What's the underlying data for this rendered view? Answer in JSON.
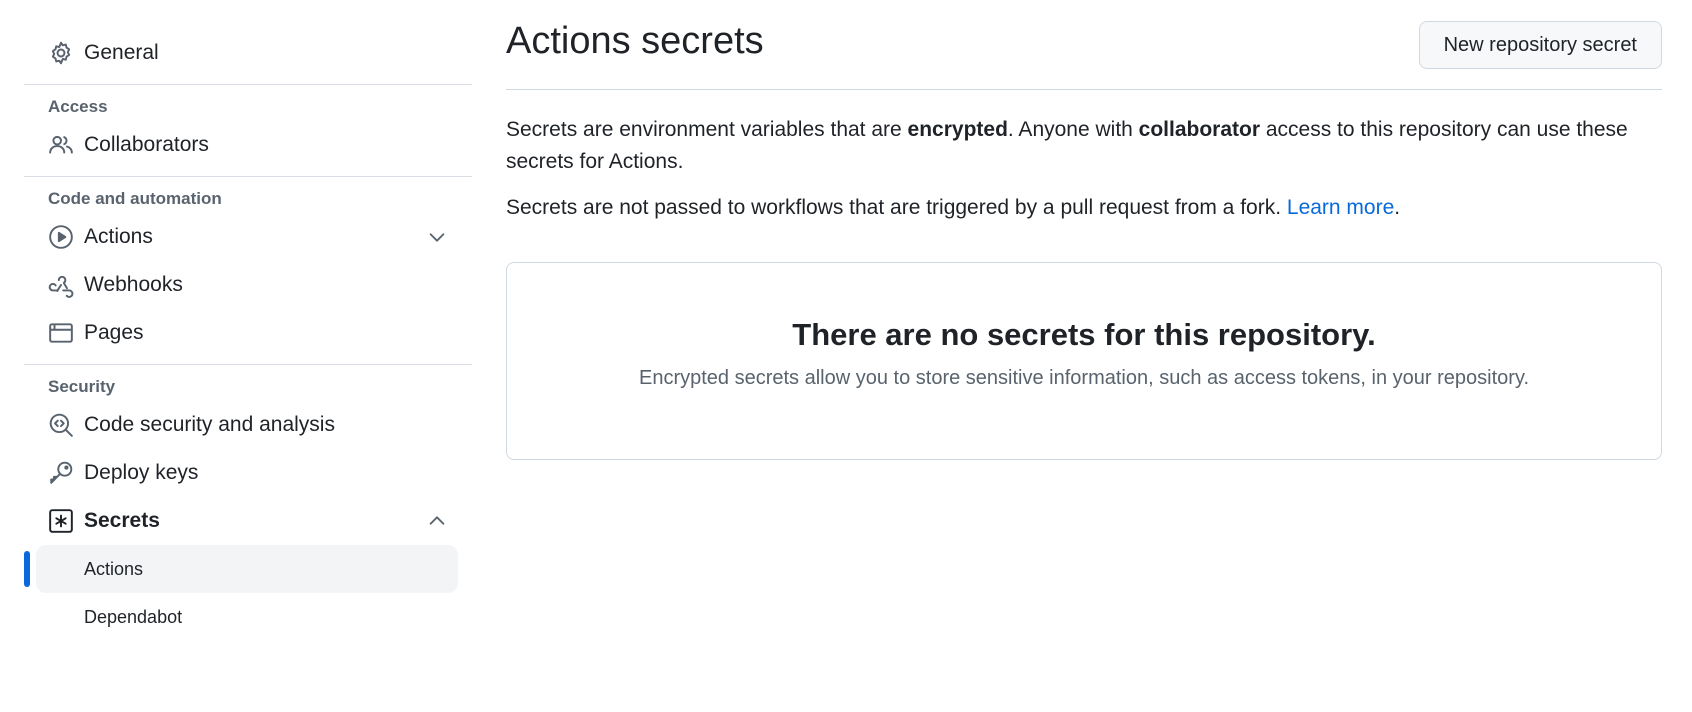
{
  "sidebar": {
    "general": {
      "label": "General",
      "icon": "gear-icon"
    },
    "access": {
      "title": "Access",
      "collaborators": {
        "label": "Collaborators",
        "icon": "people-icon"
      }
    },
    "code_automation": {
      "title": "Code and automation",
      "actions": {
        "label": "Actions",
        "icon": "play-icon"
      },
      "webhooks": {
        "label": "Webhooks",
        "icon": "webhook-icon"
      },
      "pages": {
        "label": "Pages",
        "icon": "browser-icon"
      }
    },
    "security": {
      "title": "Security",
      "code_security": {
        "label": "Code security and analysis",
        "icon": "codescan-icon"
      },
      "deploy_keys": {
        "label": "Deploy keys",
        "icon": "key-icon"
      },
      "secrets": {
        "label": "Secrets",
        "icon": "asterisk-icon",
        "sub_items": [
          {
            "label": "Actions",
            "active": true
          },
          {
            "label": "Dependabot",
            "active": false
          }
        ]
      }
    }
  },
  "main": {
    "title": "Actions secrets",
    "new_button": "New repository secret",
    "desc1": {
      "t1": "Secrets are environment variables that are ",
      "b1": "encrypted",
      "t2": ". Anyone with ",
      "b2": "collaborator",
      "t3": " access to this repository can use these secrets for Actions."
    },
    "desc2": {
      "text": "Secrets are not passed to workflows that are triggered by a pull request from a fork. ",
      "link": "Learn more",
      "end": "."
    },
    "blank_state": {
      "title": "There are no secrets for this repository.",
      "description": "Encrypted secrets allow you to store sensitive information, such as access tokens, in your repository."
    }
  },
  "colors": {
    "accent": "#0969da",
    "text": "#1f2328",
    "muted": "#59636e",
    "border": "#d1d9e0",
    "active_bg": "#f3f4f6"
  }
}
